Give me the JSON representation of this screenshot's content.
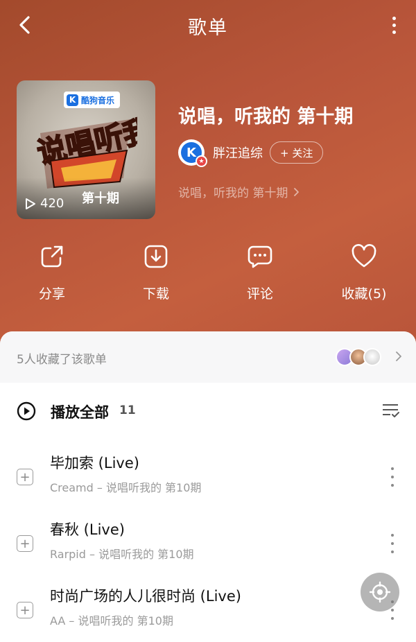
{
  "header": {
    "title": "歌单"
  },
  "cover": {
    "brand": "酷狗音乐",
    "brand_letter": "K",
    "play_count": "420",
    "episode_label": "第十期",
    "art_text": "说唱听我的"
  },
  "playlist": {
    "title": "说唱，听我的 第十期",
    "creator": {
      "avatar_letter": "K",
      "name": "胖汪追综"
    },
    "follow_label": "+ 关注",
    "description": "说唱，听我的 第十期"
  },
  "actions": [
    {
      "label": "分享",
      "icon": "share-icon"
    },
    {
      "label": "下载",
      "icon": "download-icon"
    },
    {
      "label": "评论",
      "icon": "comment-icon"
    },
    {
      "label": "收藏(5)",
      "icon": "heart-icon"
    }
  ],
  "collect": {
    "text": "5人收藏了该歌单"
  },
  "play_all": {
    "label": "播放全部",
    "count": "11"
  },
  "tracks": [
    {
      "name": "毕加索 (Live)",
      "sub": "Creamd – 说唱听我的 第10期"
    },
    {
      "name": "春秋 (Live)",
      "sub": "Rarpid – 说唱听我的 第10期"
    },
    {
      "name": "时尚广场的人儿很时尚 (Live)",
      "sub": "AA – 说唱听我的 第10期"
    }
  ],
  "colors": {
    "hero_gradient_start": "#a34a2c",
    "hero_gradient_end": "#c45f3e",
    "brand_blue": "#1a6fe0"
  }
}
